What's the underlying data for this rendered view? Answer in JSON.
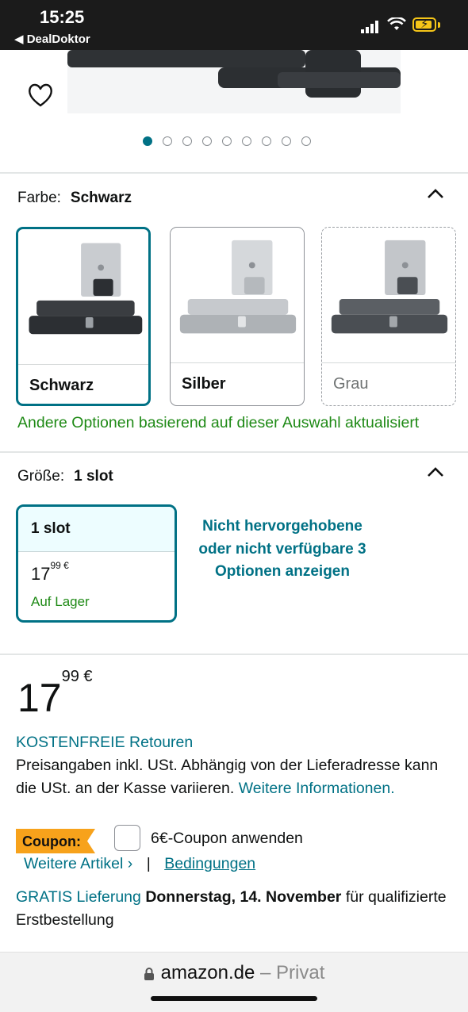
{
  "status_bar": {
    "time": "15:25",
    "back_app": "◀ DealDoktor"
  },
  "gallery": {
    "dots_total": 9,
    "active_dot": 1
  },
  "color_option": {
    "label": "Farbe:",
    "selected": "Schwarz",
    "swatches": [
      {
        "name": "Schwarz",
        "tone": "#3a3d41",
        "state": "selected"
      },
      {
        "name": "Silber",
        "tone": "#bfc3c7",
        "state": "available"
      },
      {
        "name": "Grau",
        "tone": "#55595e",
        "state": "unavailable"
      }
    ],
    "note": "Andere Optionen basierend auf dieser Auswahl aktualisiert"
  },
  "size_option": {
    "label": "Größe:",
    "selected": "1 slot",
    "box": {
      "title": "1 slot",
      "price_main": "17",
      "price_sup": "99 €",
      "stock": "Auf Lager"
    },
    "more_options": "Nicht hervorgehobene oder nicht verfügbare 3 Optionen anzeigen"
  },
  "price": {
    "main": "17",
    "sup": "99 €"
  },
  "returns_link": "KOSTENFREIE Retouren",
  "tax_text": "Preisangaben inkl. USt. Abhängig von der Lieferadresse kann die USt. an der Kasse variieren.",
  "tax_link": "Weitere Informationen.",
  "coupon": {
    "badge": "Coupon:",
    "text": "6€-Coupon anwenden",
    "more_link": "Weitere Artikel ›",
    "separator": "|",
    "terms_link": "Bedingungen"
  },
  "delivery": {
    "link": "GRATIS Lieferung",
    "date": "Donnerstag, 14. November",
    "rest": "für qualifizierte Erstbestellung"
  },
  "browser": {
    "domain": "amazon.de",
    "mode": "– Privat"
  },
  "colors": {
    "link": "#007185",
    "success": "#1f8a16",
    "coupon_badge": "#f7a21b",
    "status_bar": "#1b1b1b"
  }
}
